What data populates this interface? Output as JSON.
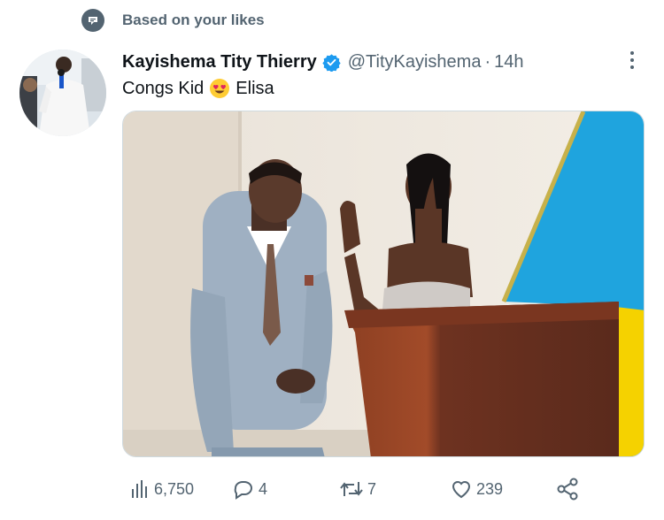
{
  "context": {
    "label": "Based on your likes",
    "icon": "topic-bubble-icon"
  },
  "tweet": {
    "author_name": "Kayishema Tity Thierry",
    "handle": "@TityKayishema",
    "separator": "·",
    "time": "14h",
    "text_before": "Congs Kid",
    "emoji": "heart-eyes-emoji",
    "text_after": "Elisa"
  },
  "actions": {
    "views": "6,750",
    "replies": "4",
    "retweets": "7",
    "likes": "239"
  },
  "colors": {
    "secondary_text": "#536471",
    "verified_blue": "#1d9bf0",
    "flag_blue": "#1fa4de",
    "flag_yellow": "#f5d200",
    "flag_fringe": "#c7b14a"
  }
}
